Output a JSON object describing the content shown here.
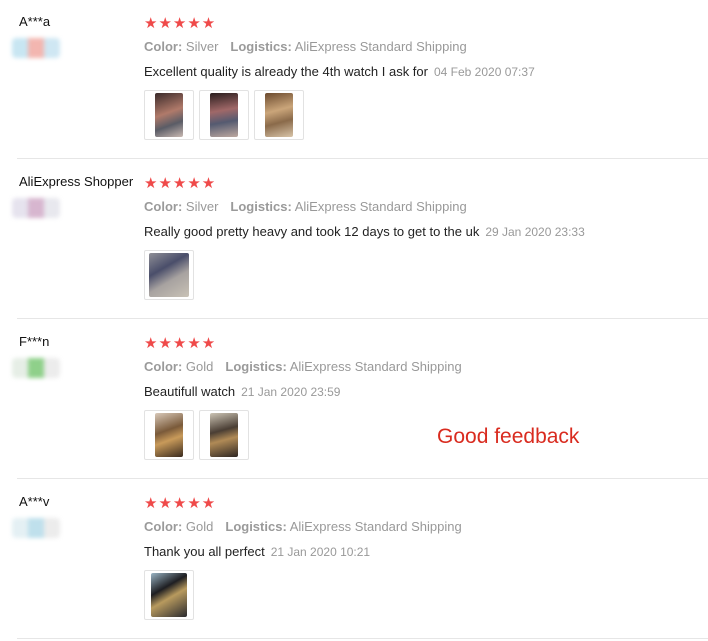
{
  "reviews": [
    {
      "name": "A***a",
      "stars": "★★★★★",
      "color_label": "Color:",
      "color_value": "Silver",
      "logistics_label": "Logistics:",
      "logistics_value": "AliExpress Standard Shipping",
      "text": "Excellent quality is already the 4th watch I ask for",
      "date": "04 Feb 2020 07:37",
      "photo_count": 3
    },
    {
      "name": "AliExpress Shopper",
      "stars": "★★★★★",
      "color_label": "Color:",
      "color_value": "Silver",
      "logistics_label": "Logistics:",
      "logistics_value": "AliExpress Standard Shipping",
      "text": "Really good pretty heavy and took 12 days to get to the uk",
      "date": "29 Jan 2020 23:33",
      "photo_count": 1
    },
    {
      "name": "F***n",
      "stars": "★★★★★",
      "color_label": "Color:",
      "color_value": "Gold",
      "logistics_label": "Logistics:",
      "logistics_value": "AliExpress Standard Shipping",
      "text": "Beautifull watch",
      "date": "21 Jan 2020 23:59",
      "photo_count": 2
    },
    {
      "name": "A***v",
      "stars": "★★★★★",
      "color_label": "Color:",
      "color_value": "Gold",
      "logistics_label": "Logistics:",
      "logistics_value": "AliExpress Standard Shipping",
      "text": "Thank you all perfect",
      "date": "21 Jan 2020 10:21",
      "photo_count": 1
    }
  ],
  "annotation": "Good feedback",
  "colors": {
    "star": "#ef4a4a",
    "annotation": "#d92b1f",
    "muted": "#999999"
  }
}
